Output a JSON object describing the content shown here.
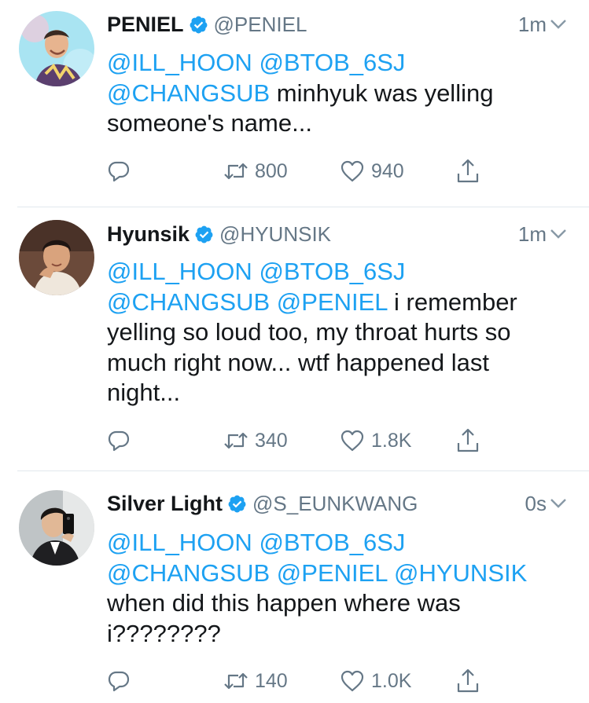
{
  "tweets": [
    {
      "name": "PENIEL",
      "handle": "@PENIEL",
      "time": "1m",
      "verified": true,
      "lines": [
        [
          {
            "text": "@ILL_HOON",
            "mention": true
          },
          {
            "text": " ",
            "mention": false
          },
          {
            "text": "@BTOB_6SJ",
            "mention": true
          }
        ],
        [
          {
            "text": "@CHANGSUB",
            "mention": true
          },
          {
            "text": " minhyuk was yelling",
            "mention": false
          }
        ],
        [
          {
            "text": "someone's name...",
            "mention": false
          }
        ]
      ],
      "retweets": "800",
      "likes": "940"
    },
    {
      "name": "Hyunsik",
      "handle": "@HYUNSIK",
      "time": "1m",
      "verified": true,
      "lines": [
        [
          {
            "text": "@ILL_HOON",
            "mention": true
          },
          {
            "text": " ",
            "mention": false
          },
          {
            "text": "@BTOB_6SJ",
            "mention": true
          }
        ],
        [
          {
            "text": "@CHANGSUB",
            "mention": true
          },
          {
            "text": " ",
            "mention": false
          },
          {
            "text": "@PENIEL",
            "mention": true
          },
          {
            "text": " i remember",
            "mention": false
          }
        ],
        [
          {
            "text": "yelling so loud too, my throat hurts so",
            "mention": false
          }
        ],
        [
          {
            "text": "much right now... wtf happened last",
            "mention": false
          }
        ],
        [
          {
            "text": "night...",
            "mention": false
          }
        ]
      ],
      "retweets": "340",
      "likes": "1.8K"
    },
    {
      "name": "Silver Light",
      "handle": "@S_EUNKWANG",
      "time": "0s",
      "verified": true,
      "lines": [
        [
          {
            "text": "@ILL_HOON",
            "mention": true
          },
          {
            "text": " ",
            "mention": false
          },
          {
            "text": "@BTOB_6SJ",
            "mention": true
          }
        ],
        [
          {
            "text": "@CHANGSUB",
            "mention": true
          },
          {
            "text": " ",
            "mention": false
          },
          {
            "text": "@PENIEL",
            "mention": true
          },
          {
            "text": " ",
            "mention": false
          },
          {
            "text": "@HYUNSIK",
            "mention": true
          }
        ],
        [
          {
            "text": "when did this happen where was",
            "mention": false
          }
        ],
        [
          {
            "text": "i????????",
            "mention": false
          }
        ]
      ],
      "retweets": "140",
      "likes": "1.0K"
    }
  ],
  "icons": {
    "reply": "reply-icon",
    "retweet": "retweet-icon",
    "like": "heart-icon",
    "share": "share-icon",
    "verified": "verified-badge-icon",
    "caret": "chevron-down-icon"
  },
  "colors": {
    "mention": "#1da1f2",
    "verified": "#1da1f2",
    "muted": "#657786",
    "text": "#14171a",
    "divider": "#e1e8ed"
  }
}
